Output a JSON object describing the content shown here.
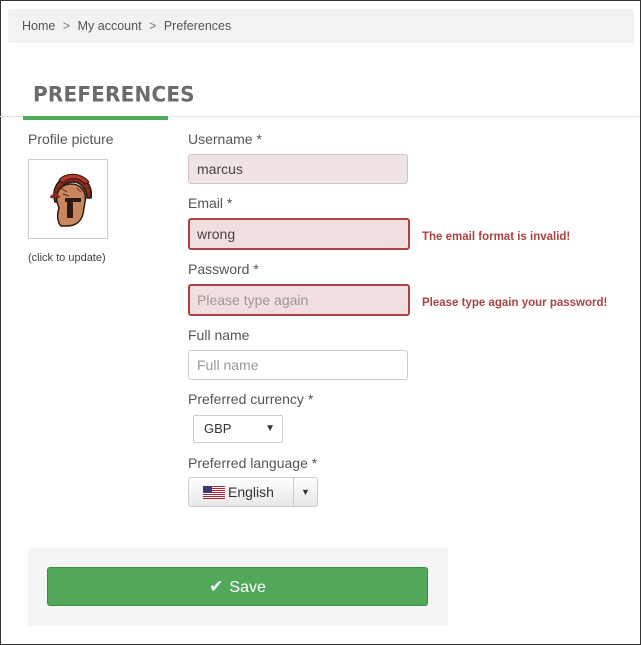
{
  "breadcrumb": {
    "items": [
      "Home",
      "My account",
      "Preferences"
    ],
    "separator": ">"
  },
  "tab": {
    "label": "PREFERENCES"
  },
  "profile": {
    "label": "Profile picture",
    "hint": "(click to update)"
  },
  "form": {
    "username": {
      "label": "Username *",
      "value": "marcus"
    },
    "email": {
      "label": "Email *",
      "value": "wrong",
      "error": "The email format is invalid!"
    },
    "password": {
      "label": "Password *",
      "placeholder": "Please type again",
      "error": "Please type again your password!"
    },
    "fullname": {
      "label": "Full name",
      "placeholder": "Full name"
    },
    "currency": {
      "label": "Preferred currency *",
      "selected": "GBP"
    },
    "language": {
      "label": "Preferred language *",
      "selected": "English"
    }
  },
  "actions": {
    "save_label": "Save"
  },
  "colors": {
    "accent": "#4daa57",
    "error": "#a94442",
    "error_bg": "#f2dede",
    "save_button": "#52a85a"
  }
}
